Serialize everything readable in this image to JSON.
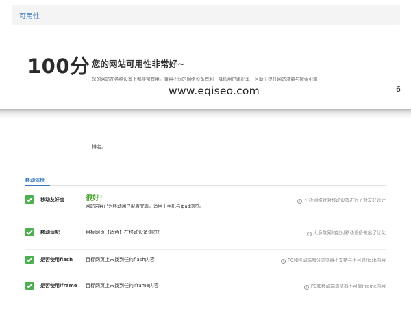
{
  "header": {
    "title": "可用性"
  },
  "summary": {
    "score": "100分",
    "headline": "您的网站可用性非常好~",
    "description": "您的网站在各种设备上都非常有用。兼容不同的网络设备有利于降低用户跳出率，且助于提升网站流量与搜索引擎",
    "watermark": "www.eqiseo.com",
    "page_number": "6"
  },
  "rank_text": "排名。",
  "mobile": {
    "tab_label": "移动体检",
    "rows": [
      {
        "name": "移动友好度",
        "status": "很好！",
        "result": "网站内容已为移动用户配置完善，适用于手机与ipad浏览。",
        "tip": "分析网络针对移动设备进行了对友好设计"
      },
      {
        "name": "移动适配",
        "status": "",
        "result": "目标网页【适合】在移动设备浏览！",
        "tip": "大多数网络针对移动设备做出了优化"
      },
      {
        "name": "是否使用flash",
        "status": "",
        "result": "目标网页上未找到任何flash内容",
        "tip": "PC和移动端部分浏览器不支持与不可靠flash内容"
      },
      {
        "name": "是否使用iframe",
        "status": "",
        "result": "目标网页上未找到任何iframe内容",
        "tip": "PC和移动端浏览器不可靠iframe内容"
      }
    ]
  },
  "colors": {
    "accent": "#3a7bbf",
    "check": "#4caf50",
    "good": "#4aa52e"
  },
  "icons": {
    "row_status": "checkmark-icon",
    "tip": "info-icon"
  }
}
